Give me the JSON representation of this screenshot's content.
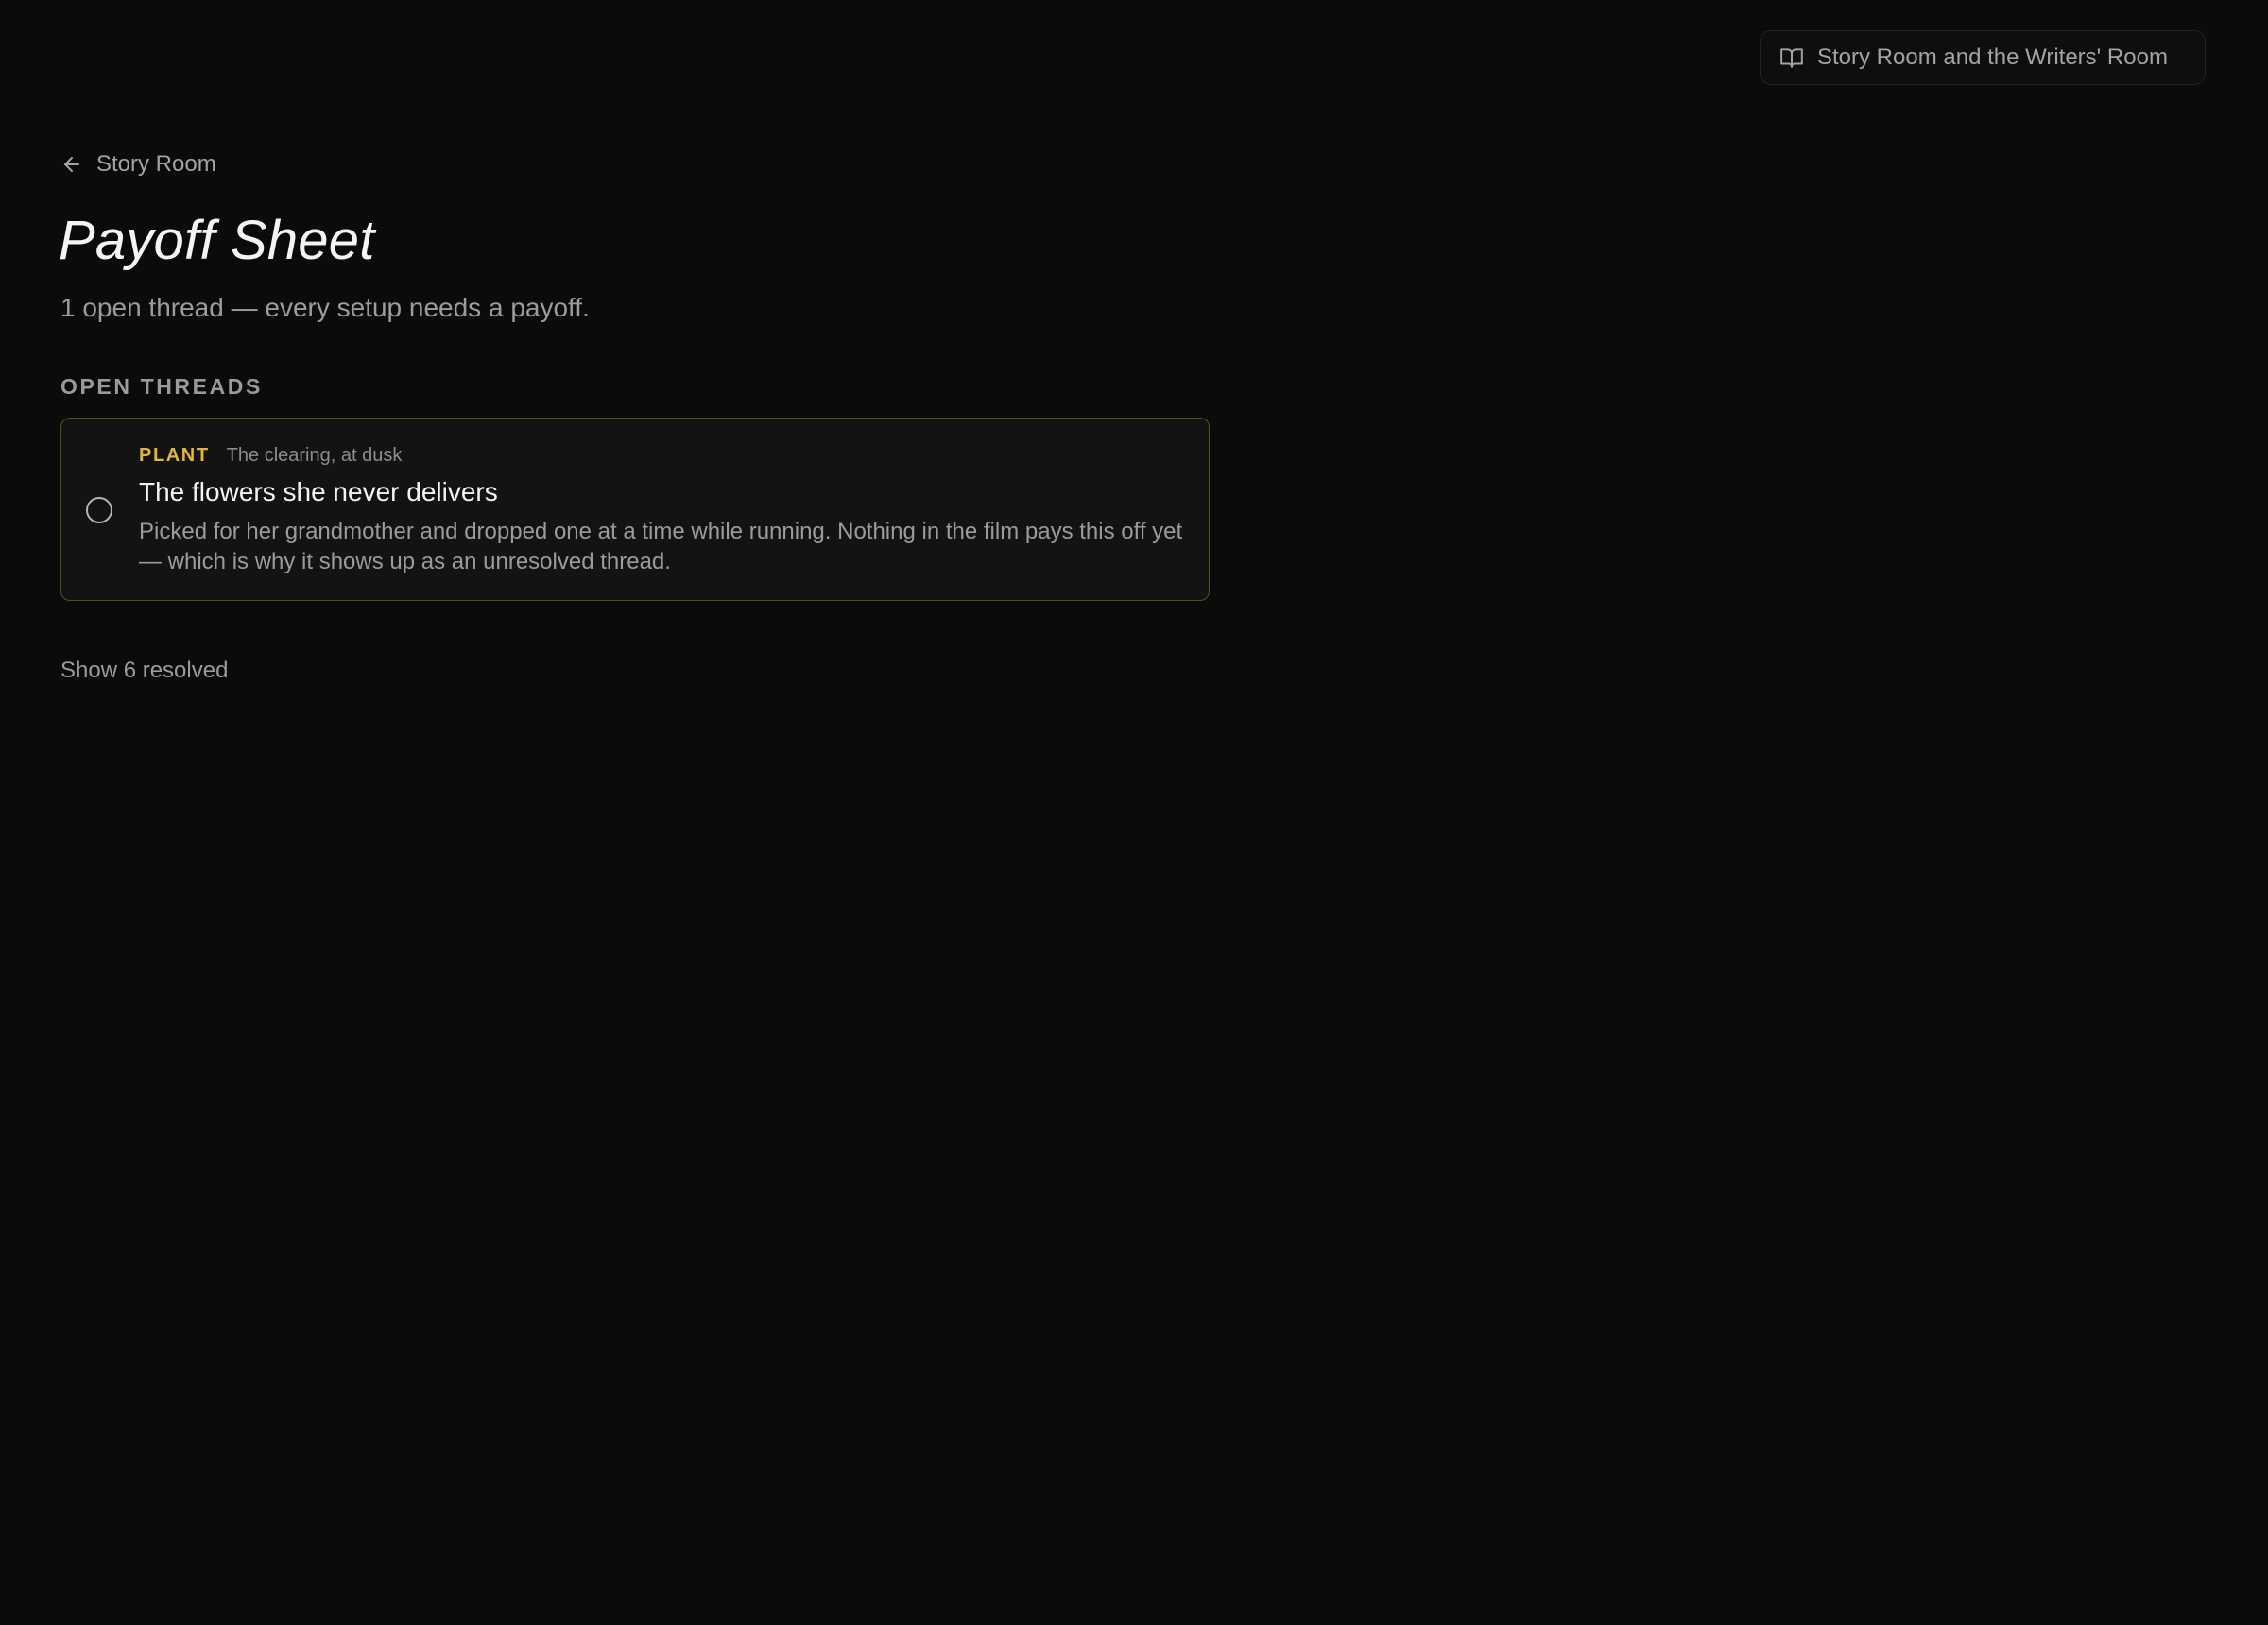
{
  "guide": {
    "label": "Story Room and the Writers' Room",
    "icon": "book-open-icon"
  },
  "nav": {
    "back_label": "Story Room",
    "back_icon": "arrow-left-icon"
  },
  "page": {
    "title": "Payoff Sheet",
    "subtitle": "1 open thread — every setup needs a payoff."
  },
  "open_threads": {
    "heading": "OPEN THREADS",
    "items": [
      {
        "tag": "PLANT",
        "location": "The clearing, at dusk",
        "title": "The flowers she never delivers",
        "description": "Picked for her grandmother and dropped one at a time while running. Nothing in the film pays this off yet — which is why it shows up as an unresolved thread.",
        "resolved": false
      }
    ]
  },
  "resolved_toggle": {
    "label": "Show 6 resolved"
  },
  "colors": {
    "background": "#0b0b0b",
    "card_border": "#5e4c17",
    "tag_accent": "#e3b53b"
  }
}
